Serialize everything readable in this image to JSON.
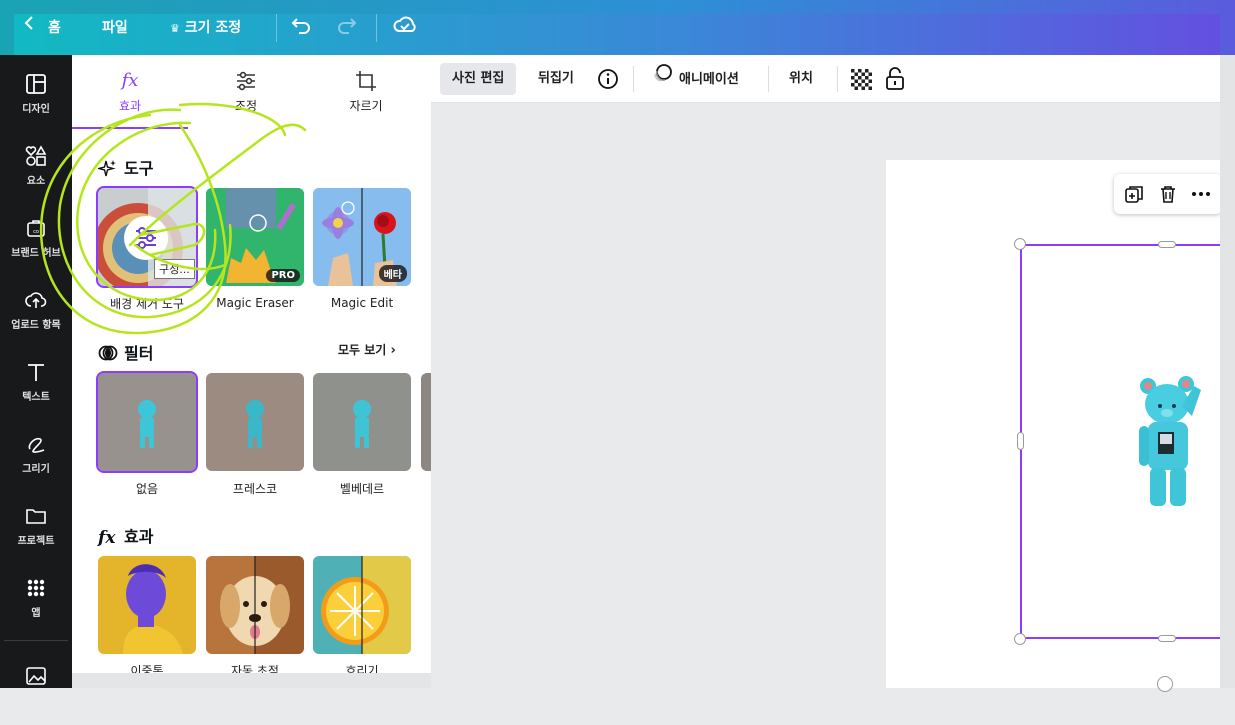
{
  "topbar": {
    "home": "홈",
    "file": "파일",
    "resize": "크기 조정"
  },
  "rail": [
    {
      "label": "디자인",
      "icon": "layout-icon"
    },
    {
      "label": "요소",
      "icon": "shapes-icon"
    },
    {
      "label": "브랜드 허브",
      "icon": "brand-icon"
    },
    {
      "label": "업로드 항목",
      "icon": "upload-icon"
    },
    {
      "label": "텍스트",
      "icon": "text-icon"
    },
    {
      "label": "그리기",
      "icon": "draw-icon"
    },
    {
      "label": "프로젝트",
      "icon": "folder-icon"
    },
    {
      "label": "앱",
      "icon": "apps-icon"
    }
  ],
  "panel": {
    "tabs": [
      {
        "label": "효과",
        "icon": "fx-icon"
      },
      {
        "label": "조정",
        "icon": "sliders-icon"
      },
      {
        "label": "자르기",
        "icon": "crop-icon"
      }
    ],
    "tools": {
      "title": "도구",
      "items": [
        {
          "label": "배경 제거 도구"
        },
        {
          "label": "Magic Eraser",
          "badge": "PRO"
        },
        {
          "label": "Magic Edit",
          "badge": "베타"
        }
      ],
      "tooltip": "구성..."
    },
    "filters": {
      "title": "필터",
      "see_all": "모두 보기",
      "items": [
        {
          "label": "없음"
        },
        {
          "label": "프레스코"
        },
        {
          "label": "벨베데르"
        }
      ]
    },
    "effects": {
      "title": "효과",
      "items": [
        {
          "label": "이중톤"
        },
        {
          "label": "자동 초점"
        },
        {
          "label": "흐리기"
        }
      ]
    }
  },
  "toolbar": {
    "edit_photo": "사진 편집",
    "flip": "뒤집기",
    "animate": "애니메이션",
    "position": "위치"
  },
  "colors": {
    "accent": "#8b3dff",
    "rail_bg": "#18191b",
    "annotation": "#b5e61d"
  }
}
